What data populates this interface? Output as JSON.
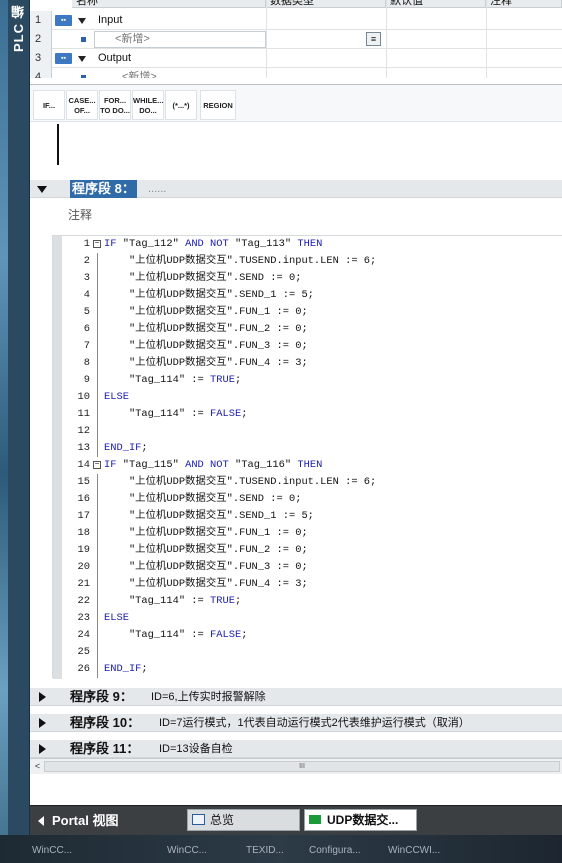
{
  "side_tab": {
    "label": "PLC 编辑"
  },
  "interface": {
    "headers": [
      "名称",
      "数据类型",
      "默认值",
      "注释"
    ],
    "rows": [
      {
        "num": "1",
        "name": "Input",
        "type": "section"
      },
      {
        "num": "2",
        "name": "<新增>",
        "type": "new"
      },
      {
        "num": "3",
        "name": "Output",
        "type": "section"
      },
      {
        "num": "4",
        "name": "<新增>",
        "type": "partial"
      }
    ]
  },
  "toolbar": {
    "buttons": [
      {
        "label": "IF..."
      },
      {
        "label": "CASE... OF..."
      },
      {
        "label": "FOR... TO DO..."
      },
      {
        "label": "WHILE... DO..."
      },
      {
        "label": "(*...*)"
      },
      {
        "label": "REGION"
      }
    ]
  },
  "network8": {
    "title": "程序段 8：",
    "dots": "......",
    "comment_label": "注释"
  },
  "code": [
    {
      "n": "1",
      "fold": true,
      "text": "IF \"Tag_112\" AND NOT \"Tag_113\" THEN"
    },
    {
      "n": "2",
      "text": "    \"上位机UDP数据交互\".TUSEND.input.LEN := 6;"
    },
    {
      "n": "3",
      "text": "    \"上位机UDP数据交互\".SEND := 0;"
    },
    {
      "n": "4",
      "text": "    \"上位机UDP数据交互\".SEND_1 := 5;"
    },
    {
      "n": "5",
      "text": "    \"上位机UDP数据交互\".FUN_1 := 0;"
    },
    {
      "n": "6",
      "text": "    \"上位机UDP数据交互\".FUN_2 := 0;"
    },
    {
      "n": "7",
      "text": "    \"上位机UDP数据交互\".FUN_3 := 0;"
    },
    {
      "n": "8",
      "text": "    \"上位机UDP数据交互\".FUN_4 := 3;"
    },
    {
      "n": "9",
      "text": "    \"Tag_114\" := TRUE;"
    },
    {
      "n": "10",
      "text": "ELSE"
    },
    {
      "n": "11",
      "text": "    \"Tag_114\" := FALSE;"
    },
    {
      "n": "12",
      "text": ""
    },
    {
      "n": "13",
      "text": "END_IF;"
    },
    {
      "n": "14",
      "fold": true,
      "text": "IF \"Tag_115\" AND NOT \"Tag_116\" THEN"
    },
    {
      "n": "15",
      "text": "    \"上位机UDP数据交互\".TUSEND.input.LEN := 6;"
    },
    {
      "n": "16",
      "text": "    \"上位机UDP数据交互\".SEND := 0;"
    },
    {
      "n": "17",
      "text": "    \"上位机UDP数据交互\".SEND_1 := 5;"
    },
    {
      "n": "18",
      "text": "    \"上位机UDP数据交互\".FUN_1 := 0;"
    },
    {
      "n": "19",
      "text": "    \"上位机UDP数据交互\".FUN_2 := 0;"
    },
    {
      "n": "20",
      "text": "    \"上位机UDP数据交互\".FUN_3 := 0;"
    },
    {
      "n": "21",
      "text": "    \"上位机UDP数据交互\".FUN_4 := 3;"
    },
    {
      "n": "22",
      "text": "    \"Tag_114\" := TRUE;"
    },
    {
      "n": "23",
      "text": "ELSE"
    },
    {
      "n": "24",
      "text": "    \"Tag_114\" := FALSE;"
    },
    {
      "n": "25",
      "text": ""
    },
    {
      "n": "26",
      "text": "END_IF;"
    }
  ],
  "networks": [
    {
      "title": "程序段 9：",
      "comment": "ID=6,上传实时报警解除"
    },
    {
      "title": "程序段 10：",
      "comment": "ID=7运行模式，1代表自动运行模式2代表维护运行模式（取消）"
    },
    {
      "title": "程序段 11：",
      "comment": "ID=13设备自检"
    }
  ],
  "scrollbar": {
    "thumb": "III"
  },
  "portal": {
    "portal_view": "Portal 视图",
    "tabs": [
      {
        "label": "总览",
        "icon": "overview-icon"
      },
      {
        "label": "UDP数据交...",
        "icon": "block-icon",
        "active": true
      }
    ]
  },
  "taskbar": [
    "WinCC...",
    "TEXID...",
    "Configura...",
    "WinCCWI..."
  ],
  "colors": {
    "keyword": "#1b1bb3",
    "network_active": "#2f6aa9"
  }
}
